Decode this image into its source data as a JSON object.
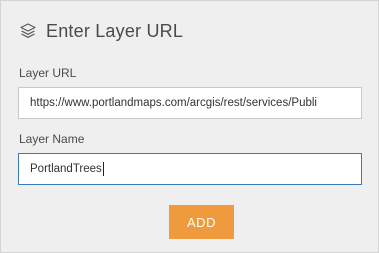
{
  "panel": {
    "title": "Enter Layer URL",
    "title_icon": "layers-icon"
  },
  "layer_url": {
    "label": "Layer URL",
    "value": "https://www.portlandmaps.com/arcgis/rest/services/Publi"
  },
  "layer_name": {
    "label": "Layer Name",
    "value": "PortlandTrees"
  },
  "add_button": {
    "label": "ADD",
    "color": "#ef9a3c"
  }
}
